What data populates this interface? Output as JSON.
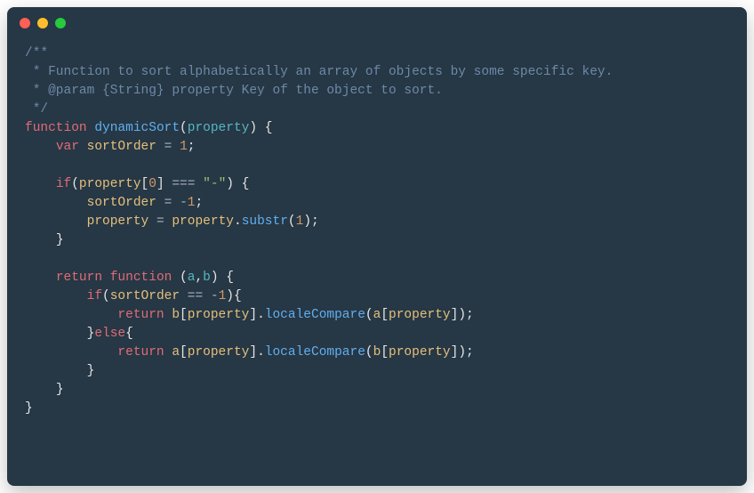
{
  "colors": {
    "bg": "#263745",
    "comment": "#6d8aa8",
    "keyword": "#e06c75",
    "function": "#61afef",
    "param": "#56b6c2",
    "variable": "#e5c07b",
    "number": "#d19a66",
    "string": "#98c379",
    "operator": "#abb2bf",
    "punctuation": "#e6e6e6"
  },
  "code": {
    "comment_open": "/**",
    "comment_line1": " * Function to sort alphabetically an array of objects by some specific key.",
    "comment_line2": " * @param {String} property Key of the object to sort.",
    "comment_close": " */",
    "kw_function": "function",
    "fn_dynamicSort": "dynamicSort",
    "paren_open": "(",
    "param_property": "property",
    "paren_close": ")",
    "brace_open": " {",
    "indent1": "    ",
    "indent2": "        ",
    "indent3": "            ",
    "kw_var": "var",
    "var_sortOrder": "sortOrder",
    "eq": " = ",
    "num_1": "1",
    "semicolon": ";",
    "kw_if": "if",
    "bracket_open": "[",
    "num_0": "0",
    "bracket_close": "]",
    "op_eqeq3": " === ",
    "str_dash": "\"-\"",
    "num_neg1": "-",
    "num_neg1b": "1",
    "dot": ".",
    "fn_substr": "substr",
    "brace_close": "}",
    "kw_return": "return",
    "param_a": "a",
    "comma": ",",
    "param_b": "b",
    "op_eqeq2": " == ",
    "fn_localeCompare": "localeCompare",
    "kw_else": "else"
  }
}
